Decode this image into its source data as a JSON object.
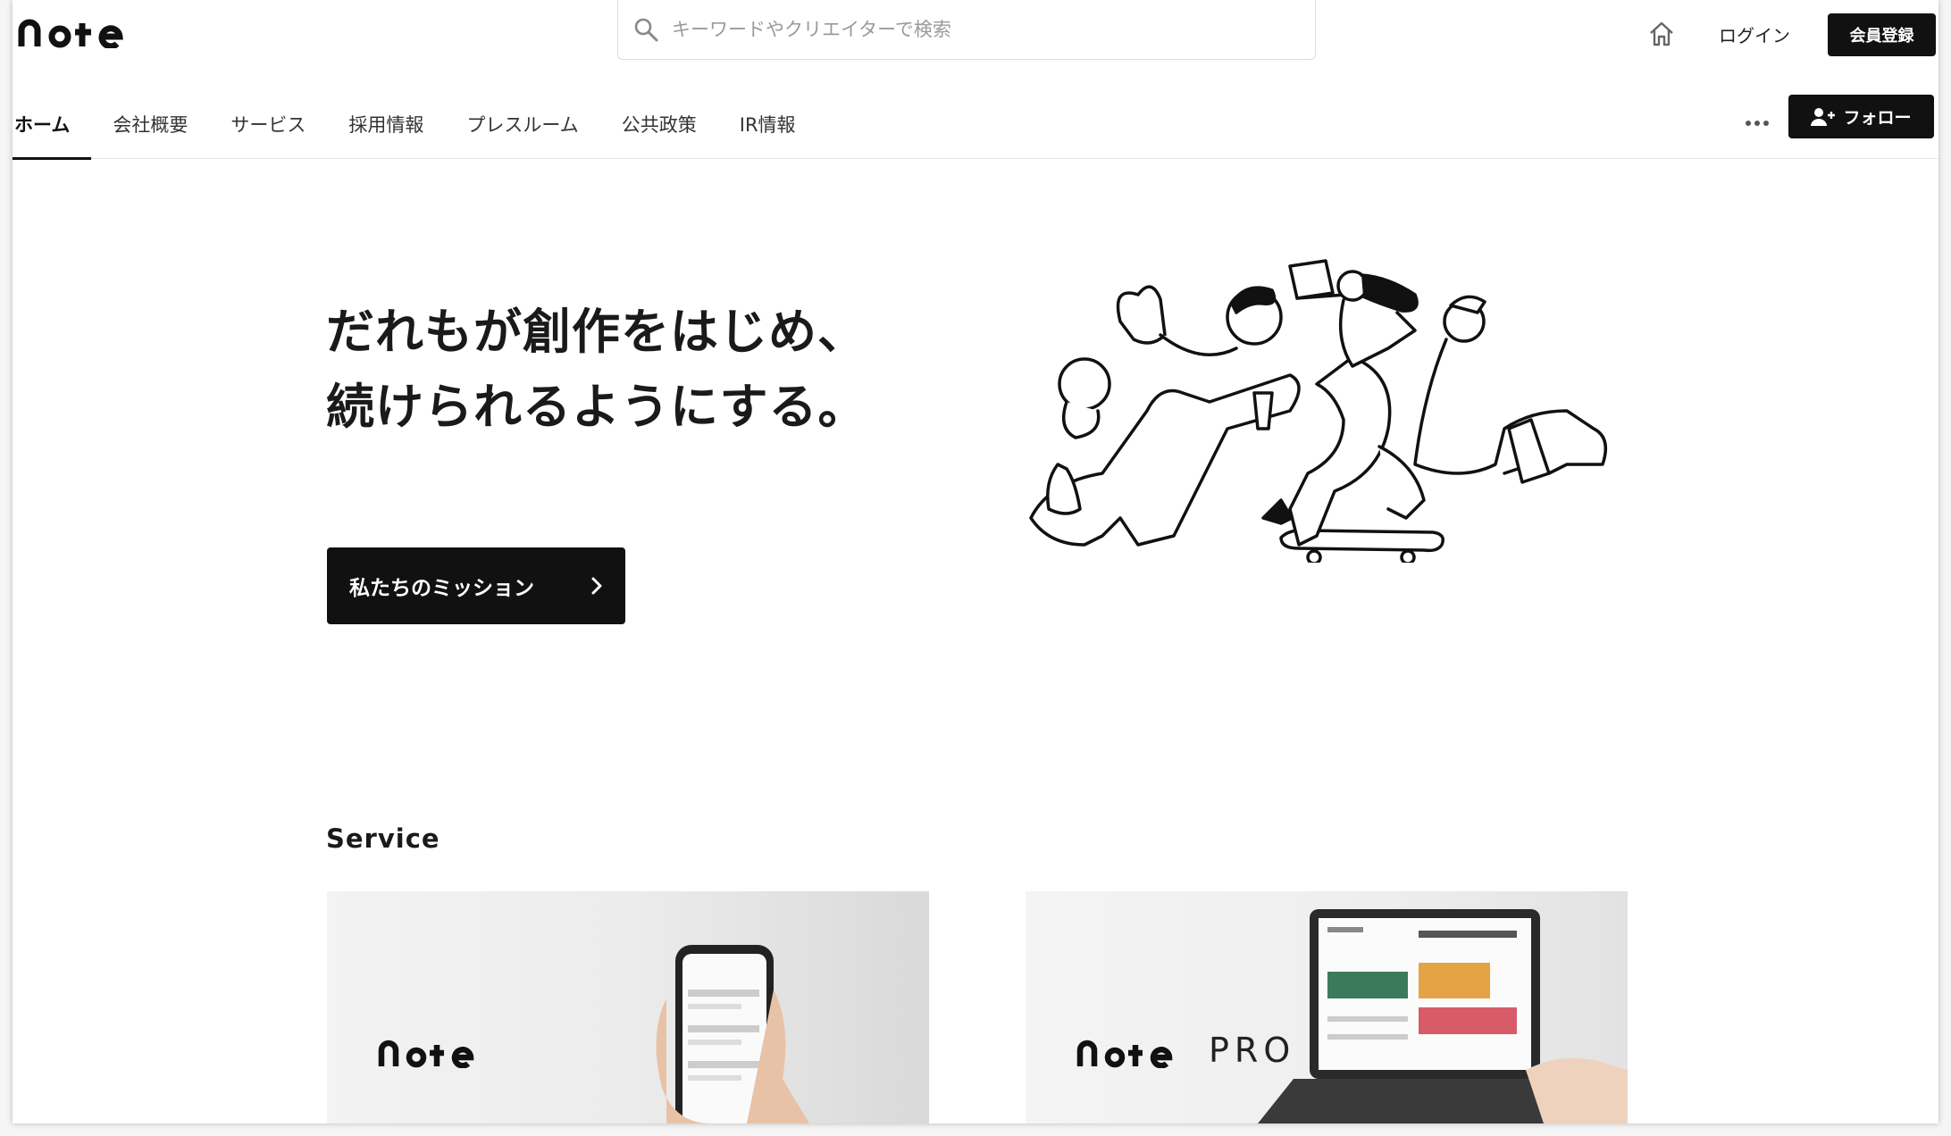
{
  "header": {
    "logo_text": "note",
    "search_placeholder": "キーワードやクリエイターで検索",
    "login_label": "ログイン",
    "signup_label": "会員登録"
  },
  "nav": {
    "tabs": [
      {
        "label": "ホーム",
        "active": true
      },
      {
        "label": "会社概要",
        "active": false
      },
      {
        "label": "サービス",
        "active": false
      },
      {
        "label": "採用情報",
        "active": false
      },
      {
        "label": "プレスルーム",
        "active": false
      },
      {
        "label": "公共政策",
        "active": false
      },
      {
        "label": "IR情報",
        "active": false
      }
    ],
    "follow_label": "フォロー"
  },
  "hero": {
    "title_line1": "だれもが創作をはじめ、",
    "title_line2": "続けられるようにする。",
    "mission_button": "私たちのミッション"
  },
  "service": {
    "heading": "Service",
    "cards": [
      {
        "logo": "note"
      },
      {
        "logo": "note",
        "suffix": "PRO"
      }
    ]
  },
  "colors": {
    "primary": "#111111",
    "background": "#ffffff",
    "border": "#e6e6e6"
  }
}
